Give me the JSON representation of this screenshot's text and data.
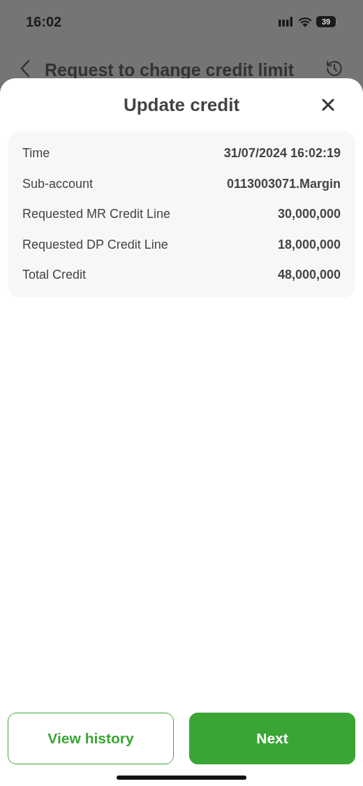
{
  "status_bar": {
    "time": "16:02",
    "battery": "39"
  },
  "header": {
    "title": "Request to change credit limit"
  },
  "sheet": {
    "title": "Update credit",
    "rows": [
      {
        "label": "Time",
        "value": "31/07/2024 16:02:19"
      },
      {
        "label": "Sub-account",
        "value": "0113003071.Margin"
      },
      {
        "label": "Requested MR Credit Line",
        "value": "30,000,000"
      },
      {
        "label": "Requested DP Credit Line",
        "value": "18,000,000"
      },
      {
        "label": "Total Credit",
        "value": "48,000,000"
      }
    ],
    "buttons": [
      {
        "label": "View history",
        "kind": "outline"
      },
      {
        "label": "Next",
        "kind": "filled"
      }
    ]
  }
}
